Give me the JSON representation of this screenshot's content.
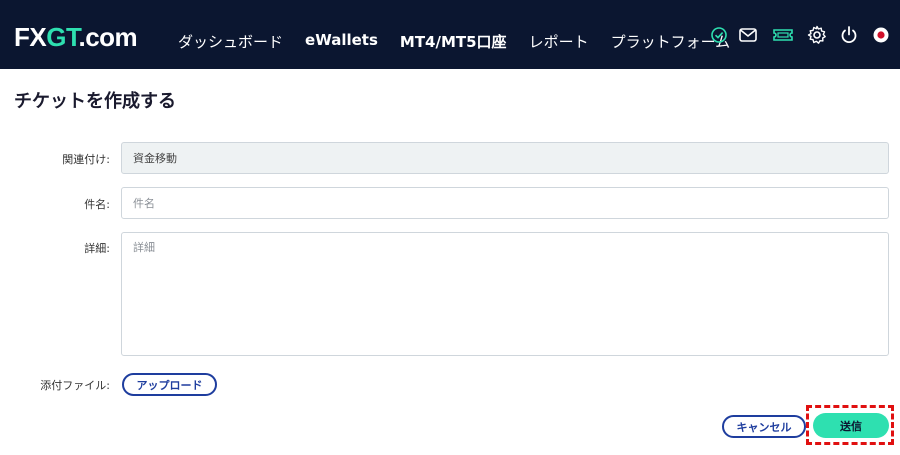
{
  "header": {
    "logo_part1": "FX",
    "logo_part2": "GT",
    "logo_part3": ".com",
    "nav": [
      {
        "label": "ダッシュボード"
      },
      {
        "label": "eWallets"
      },
      {
        "label": "MT4/MT5口座"
      },
      {
        "label": "レポート"
      },
      {
        "label": "プラットフォーム"
      }
    ],
    "icons": [
      "check-circle-icon",
      "mail-icon",
      "ticket-icon",
      "gear-icon",
      "power-icon",
      "language-flag-icon"
    ],
    "colors": {
      "bg": "#0b1630",
      "accent": "#2ee0b0"
    }
  },
  "page": {
    "title": "チケットを作成する"
  },
  "form": {
    "related_label": "関連付け:",
    "related_value": "資金移動",
    "subject_label": "件名:",
    "subject_placeholder": "件名",
    "detail_label": "詳細:",
    "detail_placeholder": "詳細",
    "attachment_label": "添付ファイル:",
    "upload_label": "アップロード",
    "cancel_label": "キャンセル",
    "submit_label": "送信"
  }
}
